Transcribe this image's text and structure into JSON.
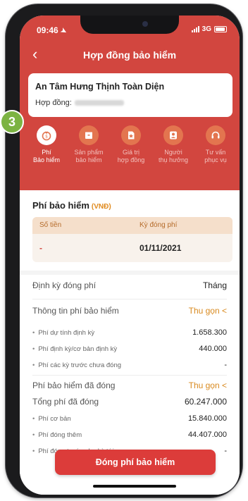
{
  "status": {
    "time": "09:46",
    "network": "3G"
  },
  "header": {
    "title": "Hợp đồng bảo hiểm"
  },
  "contract": {
    "name": "An Tâm Hưng Thịnh Toàn Diện",
    "number_label": "Hợp đồng:"
  },
  "step_badge": "3",
  "tabs": [
    {
      "line1": "Phí",
      "line2": "Bảo hiểm",
      "icon": "coin-bag-icon",
      "active": true
    },
    {
      "line1": "Sản phẩm",
      "line2": "bảo hiểm",
      "icon": "product-box-icon",
      "active": false
    },
    {
      "line1": "Giá trị",
      "line2": "hợp đồng",
      "icon": "contract-value-icon",
      "active": false
    },
    {
      "line1": "Người",
      "line2": "thụ hưởng",
      "icon": "beneficiary-icon",
      "active": false
    },
    {
      "line1": "Tư vấn",
      "line2": "phục vụ",
      "icon": "headset-icon",
      "active": false
    }
  ],
  "fee_section": {
    "title": "Phí bảo hiểm",
    "unit": "(VNĐ)",
    "col_amount": "Số tiền",
    "col_period": "Kỳ đóng phí",
    "amount_value": "-",
    "period_value": "01/11/2021"
  },
  "frequency": {
    "label": "Định kỳ đóng phí",
    "value": "Tháng"
  },
  "fee_info": {
    "title": "Thông tin phí bảo hiểm",
    "toggle": "Thu gọn <",
    "items": [
      {
        "label": "Phí dự tính định kỳ",
        "value": "1.658.300"
      },
      {
        "label": "Phí định kỳ/cơ bản định kỳ",
        "value": "440.000"
      },
      {
        "label": "Phí các kỳ trước chưa đóng",
        "value": "-"
      }
    ]
  },
  "paid": {
    "title": "Phí bảo hiểm đã đóng",
    "toggle": "Thu gọn <",
    "total_label": "Tổng phí đã đóng",
    "total_value": "60.247.000",
    "items": [
      {
        "label": "Phí cơ bản",
        "value": "15.840.000"
      },
      {
        "label": "Phí đóng thêm",
        "value": "44.407.000"
      },
      {
        "label": "Phí đóng trước cho kỳ tới",
        "value": "-"
      }
    ]
  },
  "pay_button": "Đóng phí bảo hiểm",
  "colors": {
    "primary": "#d2463f",
    "accent": "#e08a1e",
    "badge": "#7cb342"
  }
}
